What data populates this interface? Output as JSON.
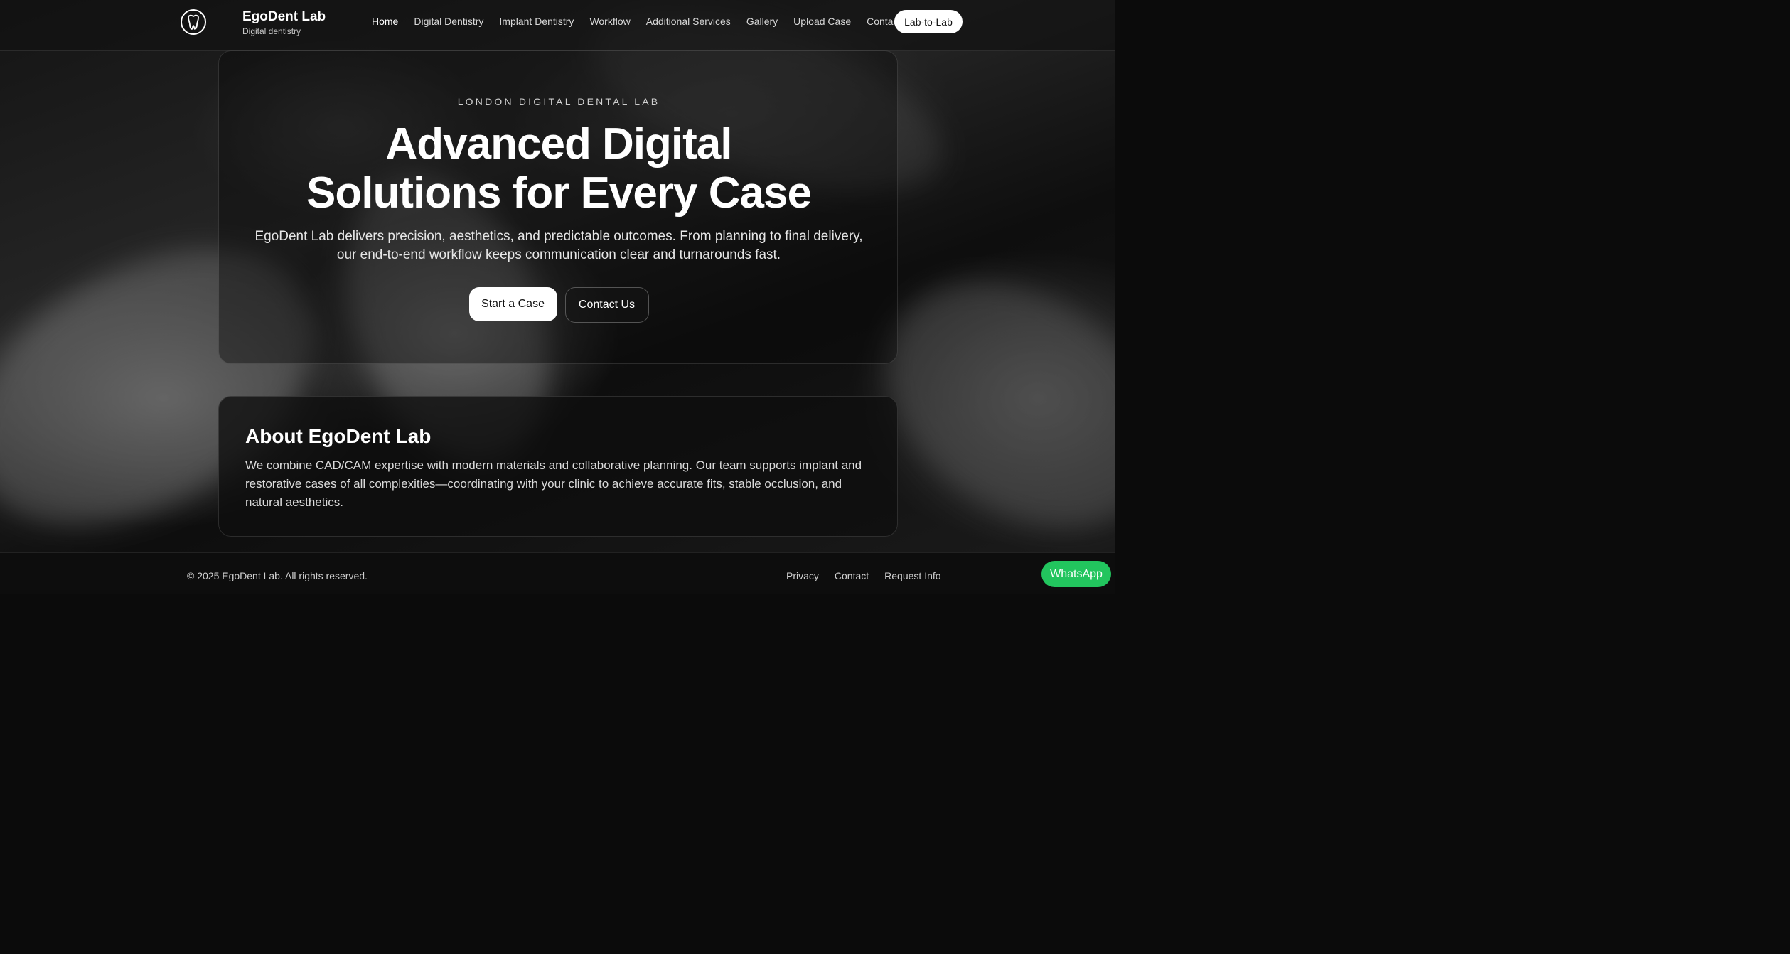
{
  "brand": {
    "name": "EgoDent Lab",
    "tagline": "Digital dentistry",
    "logo_icon": "tooth-logo-icon"
  },
  "nav": {
    "items": [
      {
        "label": "Home",
        "active": true
      },
      {
        "label": "Digital Dentistry",
        "active": false
      },
      {
        "label": "Implant Dentistry",
        "active": false
      },
      {
        "label": "Workflow",
        "active": false
      },
      {
        "label": "Additional Services",
        "active": false
      },
      {
        "label": "Gallery",
        "active": false
      },
      {
        "label": "Upload Case",
        "active": false
      },
      {
        "label": "Contact",
        "active": false
      }
    ],
    "cta_label": "Lab-to-Lab"
  },
  "hero": {
    "eyebrow": "LONDON DIGITAL DENTAL LAB",
    "headline_line1": "Advanced Digital",
    "headline_line2": "Solutions for Every Case",
    "lede_line1": "EgoDent Lab delivers precision, aesthetics, and predictable outcomes. From planning to final delivery,",
    "lede_line2": "our end-to-end workflow keeps communication clear and turnarounds fast.",
    "primary_button": "Start a Case",
    "secondary_button": "Contact Us"
  },
  "about": {
    "title": "About EgoDent Lab",
    "text": "We combine CAD/CAM expertise with modern materials and collaborative planning. Our team supports implant and restorative cases of all complexities—coordinating with your clinic to achieve accurate fits, stable occlusion, and natural aesthetics."
  },
  "footer": {
    "copyright": "© 2025 EgoDent Lab. All rights reserved.",
    "links": [
      "Privacy",
      "Contact",
      "Request Info"
    ]
  },
  "whatsapp_label": "WhatsApp",
  "colors": {
    "background": "#0b0b0b",
    "whatsapp": "#22c55e",
    "primary_button": "#ffffff"
  }
}
